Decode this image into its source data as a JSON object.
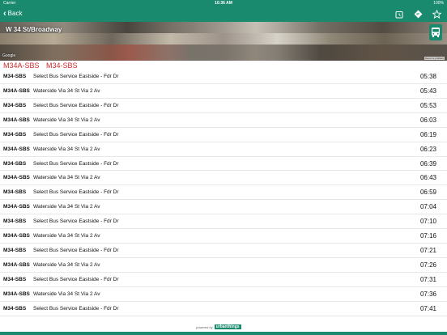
{
  "status_bar": {
    "carrier": "Carrier",
    "time": "10:36 AM",
    "battery": "100%"
  },
  "nav": {
    "back_label": "Back",
    "icons": [
      "alarm-icon",
      "directions-icon",
      "star-icon"
    ]
  },
  "stop": {
    "name": "W 34 St/Broadway",
    "attribution": "Google",
    "report": "Report a problem"
  },
  "routes": [
    "M34A-SBS",
    "M34-SBS"
  ],
  "departures": [
    {
      "route": "M34-SBS",
      "destination": "Select Bus Service Eastside - Fdr Dr",
      "time": "05:38"
    },
    {
      "route": "M34A-SBS",
      "destination": "Waterside Via 34 St Via 2 Av",
      "time": "05:43"
    },
    {
      "route": "M34-SBS",
      "destination": "Select Bus Service Eastside - Fdr Dr",
      "time": "05:53"
    },
    {
      "route": "M34A-SBS",
      "destination": "Waterside Via 34 St Via 2 Av",
      "time": "06:03"
    },
    {
      "route": "M34-SBS",
      "destination": "Select Bus Service Eastside - Fdr Dr",
      "time": "06:19"
    },
    {
      "route": "M34A-SBS",
      "destination": "Waterside Via 34 St Via 2 Av",
      "time": "06:23"
    },
    {
      "route": "M34-SBS",
      "destination": "Select Bus Service Eastside - Fdr Dr",
      "time": "06:39"
    },
    {
      "route": "M34A-SBS",
      "destination": "Waterside Via 34 St Via 2 Av",
      "time": "06:43"
    },
    {
      "route": "M34-SBS",
      "destination": "Select Bus Service Eastside - Fdr Dr",
      "time": "06:59"
    },
    {
      "route": "M34A-SBS",
      "destination": "Waterside Via 34 St Via 2 Av",
      "time": "07:04"
    },
    {
      "route": "M34-SBS",
      "destination": "Select Bus Service Eastside - Fdr Dr",
      "time": "07:10"
    },
    {
      "route": "M34A-SBS",
      "destination": "Waterside Via 34 St Via 2 Av",
      "time": "07:16"
    },
    {
      "route": "M34-SBS",
      "destination": "Select Bus Service Eastside - Fdr Dr",
      "time": "07:21"
    },
    {
      "route": "M34A-SBS",
      "destination": "Waterside Via 34 St Via 2 Av",
      "time": "07:26"
    },
    {
      "route": "M34-SBS",
      "destination": "Select Bus Service Eastside - Fdr Dr",
      "time": "07:31"
    },
    {
      "route": "M34A-SBS",
      "destination": "Waterside Via 34 St Via 2 Av",
      "time": "07:36"
    },
    {
      "route": "M34-SBS",
      "destination": "Select Bus Service Eastside - Fdr Dr",
      "time": "07:41"
    }
  ],
  "footer": {
    "powered_by": "powered by",
    "brand": "urbanthings"
  },
  "colors": {
    "brand": "#1a8a6e",
    "route_highlight": "#cc2b2b"
  }
}
